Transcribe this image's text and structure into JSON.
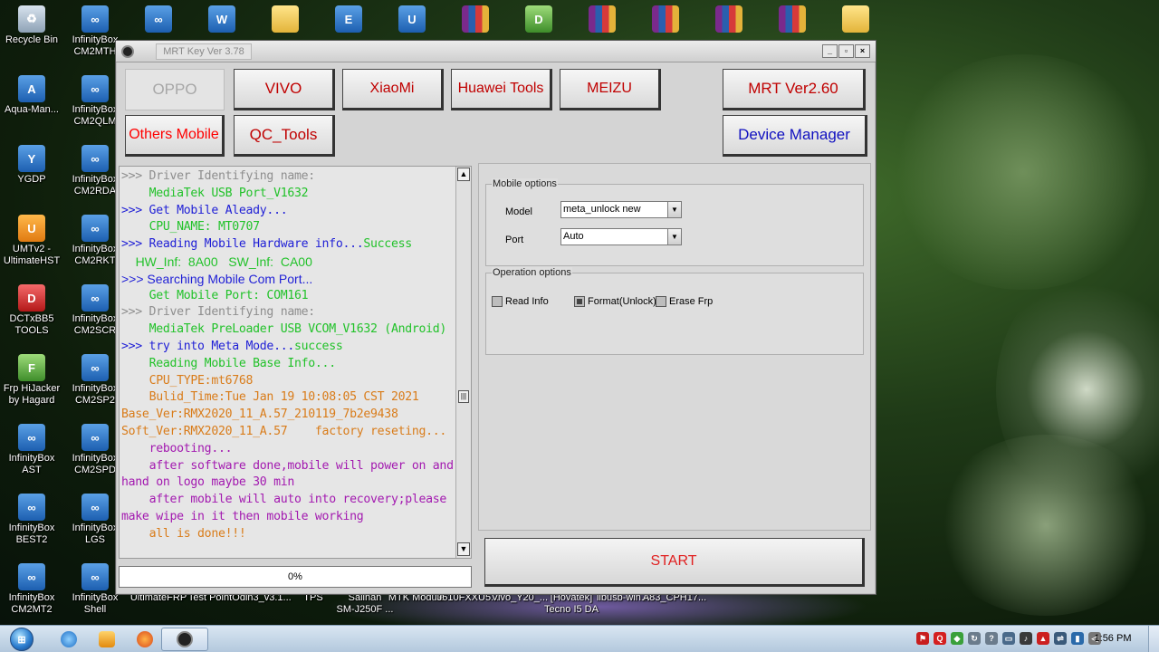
{
  "desktop": {
    "icons_left": [
      {
        "label": "Recycle Bin",
        "style": "g-bin",
        "glyph": "♻",
        "icon": "recycle-bin-icon"
      },
      {
        "label": "Aqua-Man...",
        "style": "g-blue",
        "glyph": "A",
        "icon": "aqua-man-icon"
      },
      {
        "label": "YGDP",
        "style": "g-blue",
        "glyph": "Y",
        "icon": "ygdp-icon"
      },
      {
        "label": "UMTv2 -\nUltimateHST",
        "style": "g-orange",
        "glyph": "U",
        "icon": "umt-icon"
      },
      {
        "label": "DCTxBB5\nTOOLS",
        "style": "g-red",
        "glyph": "D",
        "icon": "dct-tools-icon"
      },
      {
        "label": "Frp HiJacker\nby Hagard",
        "style": "g-green",
        "glyph": "F",
        "icon": "frp-hijacker-icon"
      },
      {
        "label": "InfinityBox\nAST",
        "style": "g-blue",
        "glyph": "∞",
        "icon": "infinitybox-icon"
      },
      {
        "label": "InfinityBox\nBEST2",
        "style": "g-blue",
        "glyph": "∞",
        "icon": "infinitybox-icon"
      },
      {
        "label": "InfinityBox\nCM2MT2",
        "style": "g-blue",
        "glyph": "∞",
        "icon": "infinitybox-icon"
      }
    ],
    "icons_second": [
      {
        "label": "InfinityBox\nCM2MTH",
        "style": "g-blue",
        "glyph": "∞",
        "icon": "infinitybox-icon"
      },
      {
        "label": "InfinityBox\nCM2QLM",
        "style": "g-blue",
        "glyph": "∞",
        "icon": "infinitybox-icon"
      },
      {
        "label": "InfinityBox\nCM2RDA",
        "style": "g-blue",
        "glyph": "∞",
        "icon": "infinitybox-icon"
      },
      {
        "label": "InfinityBox\nCM2RKT",
        "style": "g-blue",
        "glyph": "∞",
        "icon": "infinitybox-icon"
      },
      {
        "label": "InfinityBox\nCM2SCR",
        "style": "g-blue",
        "glyph": "∞",
        "icon": "infinitybox-icon"
      },
      {
        "label": "InfinityBox\nCM2SP2",
        "style": "g-blue",
        "glyph": "∞",
        "icon": "infinitybox-icon"
      },
      {
        "label": "InfinityBox\nCM2SPD",
        "style": "g-blue",
        "glyph": "∞",
        "icon": "infinitybox-icon"
      },
      {
        "label": "InfinityBox\nLGS",
        "style": "g-blue",
        "glyph": "∞",
        "icon": "infinitybox-icon"
      },
      {
        "label": "InfinityBox\nShell",
        "style": "g-blue",
        "glyph": "∞",
        "icon": "infinitybox-icon"
      }
    ],
    "bottom_row": [
      {
        "label": "UltimateFRP"
      },
      {
        "label": "Test Point"
      },
      {
        "label": "Odin3_v3.1..."
      },
      {
        "label": "TPS"
      },
      {
        "label": "Salinan\nSM-J250F ..."
      },
      {
        "label": "MTK Module"
      },
      {
        "label": "J610FXXU5..."
      },
      {
        "label": "Vivo_Y20_..."
      },
      {
        "label": "[Hovatek]\nTecno I5 DA"
      },
      {
        "label": "libusb-win..."
      },
      {
        "label": "A83_CPH17..."
      }
    ],
    "top_row": [
      {
        "style": "g-blue",
        "glyph": "∞",
        "icon": "infinitybox-icon"
      },
      {
        "style": "g-blue",
        "glyph": "W",
        "icon": "shortcut-icon"
      },
      {
        "style": "g-folder",
        "glyph": "",
        "icon": "folder-icon"
      },
      {
        "style": "g-blue",
        "glyph": "E",
        "icon": "shortcut-icon"
      },
      {
        "style": "g-blue",
        "glyph": "U",
        "icon": "shortcut-icon"
      },
      {
        "style": "g-rar",
        "glyph": "",
        "icon": "rar-archive-icon"
      },
      {
        "style": "g-green",
        "glyph": "D",
        "icon": "shortcut-icon"
      },
      {
        "style": "g-rar",
        "glyph": "",
        "icon": "rar-archive-icon"
      },
      {
        "style": "g-rar",
        "glyph": "",
        "icon": "rar-archive-icon"
      },
      {
        "style": "g-rar",
        "glyph": "",
        "icon": "rar-archive-icon"
      },
      {
        "style": "g-rar",
        "glyph": "",
        "icon": "rar-archive-icon"
      },
      {
        "style": "g-folder",
        "glyph": "",
        "icon": "folder-icon"
      }
    ]
  },
  "window": {
    "title": "MRT Key Ver 3.78",
    "controls": {
      "minimize": "_",
      "restore": "▫",
      "close": "×"
    }
  },
  "toolbar": {
    "oppo": "OPPO",
    "vivo": "VIVO",
    "xiaomi": "XiaoMi",
    "huawei": "Huawei Tools",
    "meizu": "MEIZU",
    "mrt_ver": "MRT Ver2.60",
    "others": "Others Mobile",
    "qc_tools": "QC_Tools",
    "device_manager": "Device Manager"
  },
  "colors": {
    "vivo": "#c00000",
    "xiaomi": "#c00000",
    "huawei": "#c00000",
    "meizu": "#c00000",
    "mrt_ver": "#c00000",
    "others": "#ff0000",
    "qc_tools": "#c00000",
    "device_manager": "#1010c0"
  },
  "log": [
    {
      "text": ">>> Driver Identifying name:",
      "color": "c-gray"
    },
    {
      "text": "    MediaTek USB Port_V1632",
      "color": "c-green"
    },
    {
      "text": ">>> Get Mobile Aleady...",
      "color": "c-blue"
    },
    {
      "text": "    CPU_NAME: MT0707",
      "color": "c-green"
    },
    {
      "parts": [
        {
          "text": ">>> Reading Mobile Hardware info...",
          "color": "c-blue"
        },
        {
          "text": "Success",
          "color": "c-green"
        }
      ]
    },
    {
      "text": "    HW_Inf:  8A00   SW_Inf:  CA00",
      "color": "c-green",
      "sans": true
    },
    {
      "text": ">>> Searching Mobile Com Port...",
      "color": "c-blue",
      "sans": true
    },
    {
      "text": "    Get Mobile Port: COM161",
      "color": "c-green"
    },
    {
      "text": ">>> Driver Identifying name:",
      "color": "c-gray"
    },
    {
      "text": "    MediaTek PreLoader USB VCOM_V1632 (Android)",
      "color": "c-green"
    },
    {
      "parts": [
        {
          "text": ">>> try into Meta Mode...",
          "color": "c-blue"
        },
        {
          "text": "success",
          "color": "c-green"
        }
      ]
    },
    {
      "text": "    Reading Mobile Base Info...",
      "color": "c-green"
    },
    {
      "text": "    CPU_TYPE:mt6768",
      "color": "c-orange"
    },
    {
      "text": "    Bulid_Time:Tue Jan 19 10:08:05 CST 2021",
      "color": "c-orange"
    },
    {
      "text": "Base_Ver:RMX2020_11_A.57_210119_7b2e9438",
      "color": "c-orange"
    },
    {
      "parts": [
        {
          "text": "Soft_Ver:RMX2020_11_A.57",
          "color": "c-orange"
        },
        {
          "text": "    factory reseting...",
          "color": "c-orange"
        }
      ]
    },
    {
      "text": "    rebooting...",
      "color": "c-purple"
    },
    {
      "text": "    after software done,mobile will power on and hand on logo maybe 30 min",
      "color": "c-purple"
    },
    {
      "text": "    after mobile will auto into recovery;please make wipe in it then mobile working",
      "color": "c-purple"
    },
    {
      "text": "    all is done!!!",
      "color": "c-orange"
    }
  ],
  "progress": {
    "label": "0%",
    "fraction": 0.0
  },
  "mobile_options": {
    "title": "Mobile options",
    "model_label": "Model",
    "model_value": "meta_unlock new",
    "port_label": "Port",
    "port_value": "Auto"
  },
  "operation_options": {
    "title": "Operation options",
    "read_info": "Read Info",
    "read_info_checked": false,
    "format_unlock": "Format(Unlock)",
    "format_unlock_checked": true,
    "erase_frp": "Erase Frp",
    "erase_frp_checked": false
  },
  "start": "START",
  "taskbar": {
    "clock": "1:56 PM"
  }
}
